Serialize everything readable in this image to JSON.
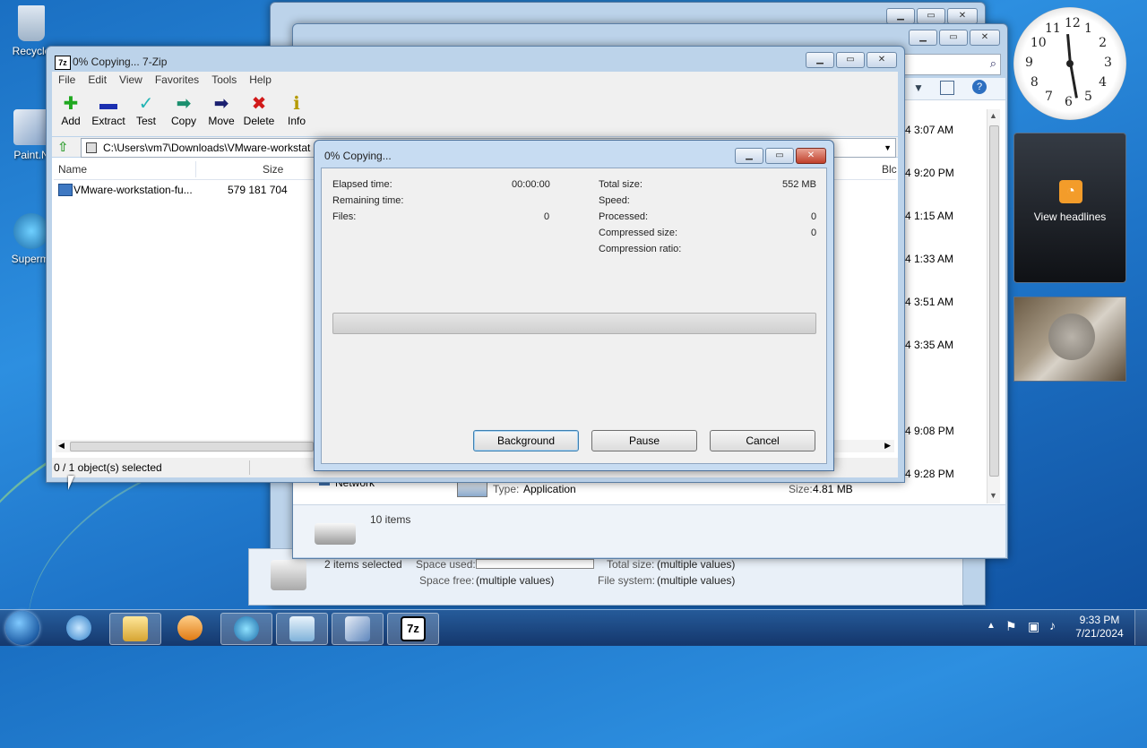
{
  "desktop": {
    "icons": [
      "Recycle",
      "Paint.N",
      "Supermi"
    ]
  },
  "back_window": {
    "dates": [
      "4 3:07 AM",
      "4 9:20 PM",
      "4 1:15 AM",
      "4 1:33 AM",
      "4 3:51 AM",
      "4 3:35 AM",
      "4 9:08 PM",
      "4 9:28 PM"
    ],
    "nav_network": "Network",
    "type_label": "Type:",
    "type_value": "Application",
    "size_label": "Size:",
    "size_value": "4.81 MB",
    "items_count": "10 items"
  },
  "far_window": {
    "selection": "2 items selected",
    "space_used_label": "Space used:",
    "total_size_label": "Total size:",
    "total_size_value": "(multiple values)",
    "space_free_label": "Space free:",
    "space_free_value": "(multiple values)",
    "file_system_label": "File system:",
    "file_system_value": "(multiple values)"
  },
  "zip_window": {
    "title": "0% Copying... 7-Zip",
    "menu": [
      "File",
      "Edit",
      "View",
      "Favorites",
      "Tools",
      "Help"
    ],
    "toolbar": [
      "Add",
      "Extract",
      "Test",
      "Copy",
      "Move",
      "Delete",
      "Info"
    ],
    "address": "C:\\Users\\vm7\\Downloads\\VMware-workstat",
    "columns": {
      "name": "Name",
      "size": "Size",
      "block": "Blc"
    },
    "rows": [
      {
        "name": "VMware-workstation-fu...",
        "size": "579 181 704"
      }
    ],
    "status": "0 / 1 object(s) selected"
  },
  "progress_dialog": {
    "title": "0% Copying...",
    "elapsed_label": "Elapsed time:",
    "elapsed_value": "00:00:00",
    "remaining_label": "Remaining time:",
    "files_label": "Files:",
    "files_value": "0",
    "total_size_label": "Total size:",
    "total_size_value": "552 MB",
    "speed_label": "Speed:",
    "processed_label": "Processed:",
    "processed_value": "0",
    "compressed_label": "Compressed size:",
    "compressed_value": "0",
    "ratio_label": "Compression ratio:",
    "progress_fraction": 0,
    "buttons": {
      "background": "Background",
      "pause": "Pause",
      "cancel": "Cancel"
    }
  },
  "gadgets": {
    "clock_numbers": [
      "12",
      "1",
      "2",
      "3",
      "4",
      "5",
      "6",
      "7",
      "8",
      "9",
      "10",
      "11"
    ],
    "feed_label": "View headlines"
  },
  "taskbar": {
    "time": "9:33 PM",
    "date": "7/21/2024"
  },
  "colors": {
    "accent": "#3c7fb1",
    "close_red": "#c0402b",
    "desktop_blue": "#1e74c8"
  }
}
